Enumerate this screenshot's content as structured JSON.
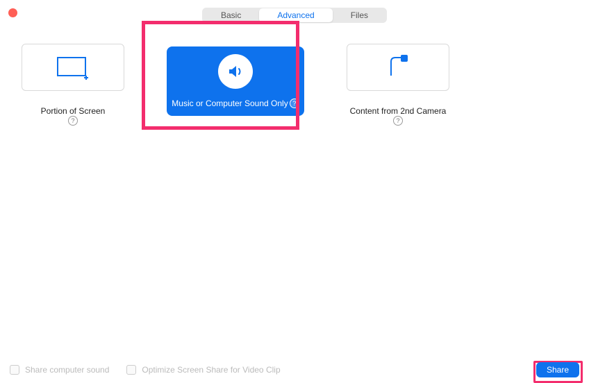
{
  "tabs": {
    "basic": "Basic",
    "advanced": "Advanced",
    "files": "Files"
  },
  "options": {
    "portionOfScreen": "Portion of Screen",
    "musicOrSound": "Music or Computer Sound Only",
    "secondCamera": "Content from 2nd Camera"
  },
  "footer": {
    "shareSound": "Share computer sound",
    "optimizeVideo": "Optimize Screen Share for Video Clip",
    "shareButton": "Share"
  },
  "glyphs": {
    "help": "?"
  },
  "colors": {
    "accent": "#0e72ed",
    "highlight": "#f32d6d"
  }
}
